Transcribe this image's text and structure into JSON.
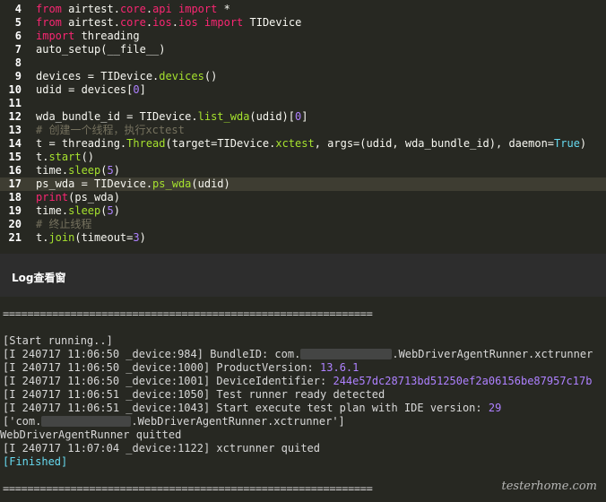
{
  "editor": {
    "lines": [
      {
        "num": "4",
        "parts": [
          {
            "t": "from",
            "c": "kw"
          },
          {
            "t": " airtest."
          },
          {
            "t": "core",
            "c": "kw"
          },
          {
            "t": "."
          },
          {
            "t": "api",
            "c": "kw"
          },
          {
            "t": " "
          },
          {
            "t": "import",
            "c": "kw"
          },
          {
            "t": " *"
          }
        ]
      },
      {
        "num": "5",
        "parts": [
          {
            "t": "from",
            "c": "kw"
          },
          {
            "t": " airtest."
          },
          {
            "t": "core",
            "c": "kw"
          },
          {
            "t": "."
          },
          {
            "t": "ios",
            "c": "kw"
          },
          {
            "t": "."
          },
          {
            "t": "ios",
            "c": "kw"
          },
          {
            "t": " "
          },
          {
            "t": "import",
            "c": "kw"
          },
          {
            "t": " TIDevice"
          }
        ]
      },
      {
        "num": "6",
        "parts": [
          {
            "t": "import",
            "c": "kw"
          },
          {
            "t": " threading"
          }
        ]
      },
      {
        "num": "7",
        "parts": [
          {
            "t": "auto_setup(__file__)"
          }
        ]
      },
      {
        "num": "8",
        "parts": []
      },
      {
        "num": "9",
        "parts": [
          {
            "t": "devices = TIDevice."
          },
          {
            "t": "devices",
            "c": "gn"
          },
          {
            "t": "()"
          }
        ]
      },
      {
        "num": "10",
        "parts": [
          {
            "t": "udid = devices["
          },
          {
            "t": "0",
            "c": "nm"
          },
          {
            "t": "]"
          }
        ]
      },
      {
        "num": "11",
        "parts": []
      },
      {
        "num": "12",
        "parts": [
          {
            "t": "wda_bundle_id = TIDevice."
          },
          {
            "t": "list_wda",
            "c": "gn"
          },
          {
            "t": "(udid)["
          },
          {
            "t": "0",
            "c": "nm"
          },
          {
            "t": "]"
          }
        ]
      },
      {
        "num": "13",
        "parts": [
          {
            "t": "# 创建一个线程，执行xctest",
            "c": "cm"
          }
        ]
      },
      {
        "num": "14",
        "parts": [
          {
            "t": "t = threading."
          },
          {
            "t": "Thread",
            "c": "gn"
          },
          {
            "t": "(target=TIDevice."
          },
          {
            "t": "xctest",
            "c": "gn"
          },
          {
            "t": ", args=(udid, wda_bundle_id), daemon="
          },
          {
            "t": "True",
            "c": "fn"
          },
          {
            "t": ")"
          }
        ]
      },
      {
        "num": "15",
        "parts": [
          {
            "t": "t."
          },
          {
            "t": "start",
            "c": "gn"
          },
          {
            "t": "()"
          }
        ]
      },
      {
        "num": "16",
        "parts": [
          {
            "t": "time."
          },
          {
            "t": "sleep",
            "c": "gn"
          },
          {
            "t": "("
          },
          {
            "t": "5",
            "c": "nm"
          },
          {
            "t": ")"
          }
        ]
      },
      {
        "num": "17",
        "current": true,
        "parts": [
          {
            "t": "ps_wda = TIDevice."
          },
          {
            "t": "ps_wda",
            "c": "gn"
          },
          {
            "t": "(udid)"
          }
        ]
      },
      {
        "num": "18",
        "parts": [
          {
            "t": "print",
            "c": "kw"
          },
          {
            "t": "(ps_wda)"
          }
        ]
      },
      {
        "num": "19",
        "parts": [
          {
            "t": "time."
          },
          {
            "t": "sleep",
            "c": "gn"
          },
          {
            "t": "("
          },
          {
            "t": "5",
            "c": "nm"
          },
          {
            "t": ")"
          }
        ]
      },
      {
        "num": "20",
        "parts": [
          {
            "t": "# 终止线程",
            "c": "cm"
          }
        ]
      },
      {
        "num": "21",
        "parts": [
          {
            "t": "t."
          },
          {
            "t": "join",
            "c": "gn"
          },
          {
            "t": "(timeout="
          },
          {
            "t": "3",
            "c": "nm"
          },
          {
            "t": ")"
          }
        ]
      }
    ]
  },
  "log_window": {
    "title": "Log查看窗"
  },
  "console": {
    "separator": "============================================================",
    "start": "[Start running..]",
    "log_lines": [
      {
        "prefix": "[I 240717 11:06:50 _device:984] BundleID: com.",
        "masked": true,
        "suffix": ".WebDriverAgentRunner.xctrunner",
        "value": ""
      },
      {
        "prefix": "[I 240717 11:06:50 _device:1000] ProductVersion: ",
        "value": "13.6.1"
      },
      {
        "prefix": "[I 240717 11:06:50 _device:1001] DeviceIdentifier: ",
        "value": "244e57dc28713bd51250ef2a06156be87957c17b"
      },
      {
        "prefix": "[I 240717 11:06:51 _device:1050] Test runner ready detected",
        "value": ""
      },
      {
        "prefix": "[I 240717 11:06:51 _device:1043] Start execute test plan with IDE version: ",
        "value": "29"
      }
    ],
    "list_output_prefix": "['com.",
    "list_output_suffix": ".WebDriverAgentRunner.xctrunner']",
    "quitted": "WebDriverAgentRunner quitted",
    "xctrunner_quit": "[I 240717 11:07:04 _device:1122] xctrunner quited",
    "finished": "[Finished]"
  },
  "watermark": "testerhome.com",
  "colors": {
    "keyword": "#f92672",
    "function": "#a6e22e",
    "number": "#ae81ff",
    "comment": "#75715e",
    "builtin": "#66d9ef"
  }
}
